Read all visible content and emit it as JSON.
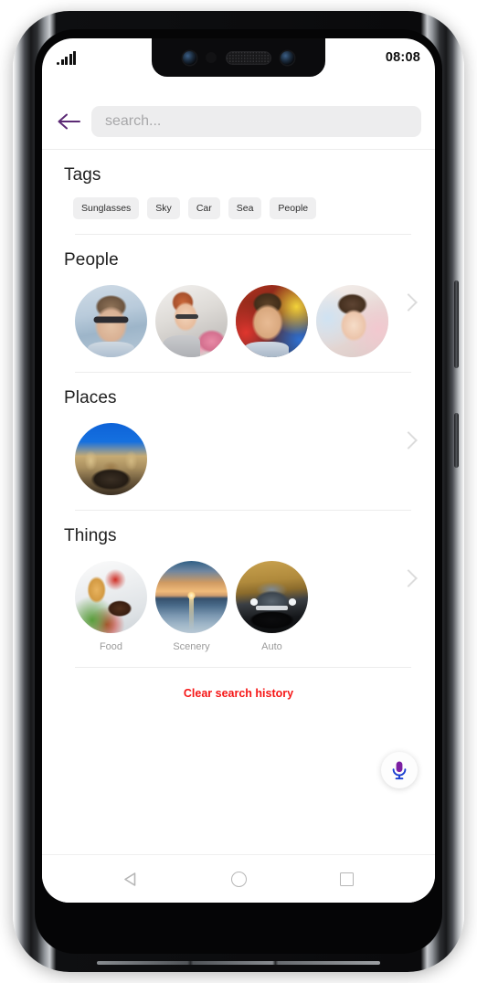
{
  "status_bar": {
    "signal_icon": "signal-bars-icon",
    "time": "08:08"
  },
  "header": {
    "back_icon": "arrow-left-icon",
    "search_value": "",
    "search_placeholder": "search..."
  },
  "sections": {
    "tags": {
      "title": "Tags",
      "items": [
        {
          "label": "Sunglasses"
        },
        {
          "label": "Sky"
        },
        {
          "label": "Car"
        },
        {
          "label": "Sea"
        },
        {
          "label": "People"
        }
      ]
    },
    "people": {
      "title": "People",
      "chevron_icon": "chevron-right-icon",
      "items": [
        {
          "label": "",
          "photo": "p1"
        },
        {
          "label": "",
          "photo": "p2"
        },
        {
          "label": "",
          "photo": "p3"
        },
        {
          "label": "",
          "photo": "p4"
        }
      ]
    },
    "places": {
      "title": "Places",
      "chevron_icon": "chevron-right-icon",
      "items": [
        {
          "label": "",
          "photo": "pl1"
        }
      ]
    },
    "things": {
      "title": "Things",
      "chevron_icon": "chevron-right-icon",
      "items": [
        {
          "label": "Food",
          "photo": "t1"
        },
        {
          "label": "Scenery",
          "photo": "t2"
        },
        {
          "label": "Auto",
          "photo": "t3"
        }
      ]
    }
  },
  "clear_history": {
    "label": "Clear search history",
    "color": "#f61616"
  },
  "mic_fab": {
    "icon": "microphone-icon",
    "head_color": "#7b1fa2",
    "stand_color": "#1a3fd0"
  },
  "nav_bar": {
    "back_icon": "nav-back-triangle-icon",
    "home_icon": "nav-home-circle-icon",
    "recents_icon": "nav-recents-square-icon"
  },
  "hardware": {
    "notch": {
      "camera_left_icon": "front-camera-icon",
      "sensor_icon": "proximity-sensor-icon",
      "speaker_icon": "earpiece-speaker-icon",
      "camera_right_icon": "front-camera-icon"
    },
    "volume_button": "volume-rocker",
    "power_button": "power-button"
  }
}
